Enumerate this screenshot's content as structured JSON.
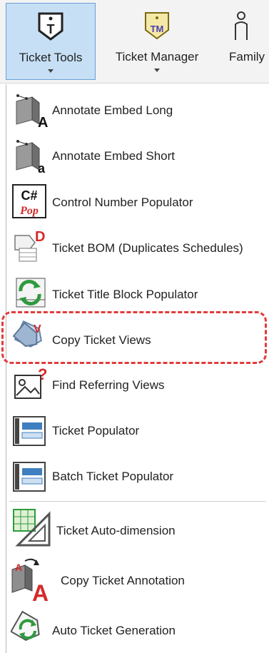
{
  "ribbon": {
    "tabs": [
      {
        "label": "Ticket Tools",
        "icon": "ticket-tools-icon"
      },
      {
        "label": "Ticket Manager",
        "icon": "ticket-manager-icon"
      },
      {
        "label": "Family",
        "icon": "family-icon"
      }
    ],
    "tools_icon_letter": "T",
    "manager_icon_letters": "TM"
  },
  "menu": {
    "items": [
      {
        "label": "Annotate Embed Long",
        "icon": "annotate-embed-long-icon",
        "glyph": "A"
      },
      {
        "label": "Annotate Embed Short",
        "icon": "annotate-embed-short-icon",
        "glyph": "a"
      },
      {
        "label": "Control Number Populator",
        "icon": "control-number-icon",
        "glyph_top": "C#",
        "glyph_bottom": "Pop"
      },
      {
        "label": "Ticket BOM (Duplicates Schedules)",
        "icon": "ticket-bom-icon",
        "glyph": "D"
      },
      {
        "label": "Ticket Title Block Populator",
        "icon": "title-block-icon"
      },
      {
        "label": "Copy Ticket Views",
        "icon": "copy-ticket-views-icon",
        "glyph": "V"
      },
      {
        "label": "Find Referring Views",
        "icon": "find-referring-views-icon",
        "glyph": "?"
      },
      {
        "label": "Ticket Populator",
        "icon": "ticket-populator-icon"
      },
      {
        "label": "Batch Ticket Populator",
        "icon": "batch-ticket-populator-icon"
      },
      {
        "label": "Ticket Auto-dimension",
        "icon": "auto-dimension-icon"
      },
      {
        "label": "Copy Ticket Annotation",
        "icon": "copy-ticket-annotation-icon",
        "glyph": "A"
      },
      {
        "label": "Auto Ticket Generation",
        "icon": "auto-ticket-generation-icon"
      }
    ]
  },
  "colors": {
    "active_tab_bg": "#c6dff5",
    "highlight": "#e23a3a",
    "accent_red": "#d42a2a",
    "accent_green": "#2e9a3e",
    "accent_blue": "#3f7fc0"
  }
}
